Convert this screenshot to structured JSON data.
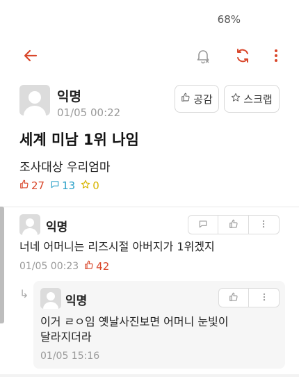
{
  "status_bar": {
    "battery": "68%"
  },
  "toolbar": {
    "back_icon": "arrow-left-icon",
    "bell_icon": "bell-off-icon",
    "refresh_icon": "refresh-icon",
    "more_icon": "more-vertical-icon",
    "accent_color": "#d9472b"
  },
  "post": {
    "author": "익명",
    "time": "01/05 00:22",
    "like_button": "공감",
    "scrap_button": "스크랩",
    "title": "세계 미남 1위 나임",
    "body": "조사대상 우리엄마",
    "likes": "27",
    "comments": "13",
    "scraps": "0"
  },
  "comments": [
    {
      "author": "익명",
      "text": "너네 어머니는 리즈시절 아버지가 1위겠지",
      "time": "01/05 00:23",
      "likes": "42"
    }
  ],
  "reply": {
    "author": "익명",
    "text_line1": "이거 ㄹㅇ임 옛날사진보면 어머니 눈빛이",
    "text_line2": "달라지더라",
    "time": "01/05 15:16"
  }
}
